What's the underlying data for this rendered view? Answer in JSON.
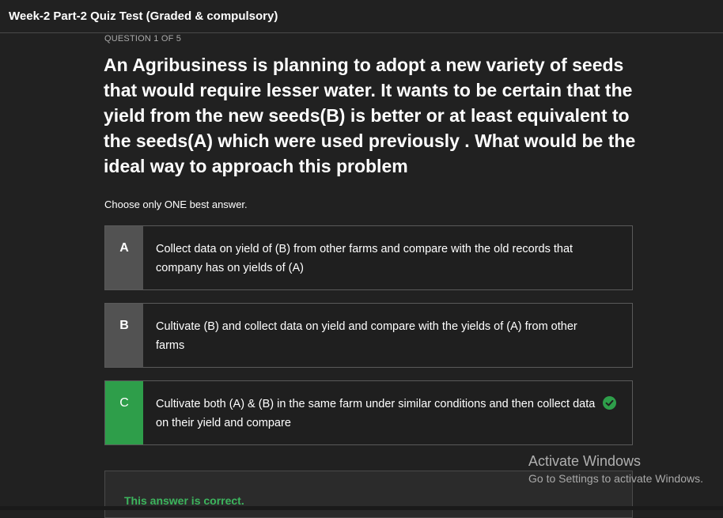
{
  "header": {
    "title": "Week-2 Part-2 Quiz Test (Graded & compulsory)"
  },
  "quiz": {
    "question_counter": "QUESTION 1 OF 5",
    "question_text": "An Agribusiness is planning to adopt a new variety of seeds that would require lesser water. It wants to be certain that the yield from the new seeds(B) is better or at least equivalent to the seeds(A) which were used previously . What would be the ideal way to approach this problem",
    "instruction": "Choose only ONE best answer.",
    "options": [
      {
        "letter": "A",
        "text": "Collect data on yield of (B) from other farms and compare with the old records that company has on yields of (A)"
      },
      {
        "letter": "B",
        "text": "Cultivate (B) and collect data on yield and compare with the yields of (A) from other farms"
      },
      {
        "letter": "C",
        "text": "Cultivate both (A) & (B) in the same farm under similar conditions and then collect data on their yield and compare",
        "selected_correct": true,
        "icon": "check-circle-icon"
      }
    ],
    "feedback": "This answer is correct."
  },
  "watermark": {
    "title": "Activate Windows",
    "subtitle": "Go to Settings to activate Windows."
  },
  "colors": {
    "background": "#212121",
    "letter_box": "#525252",
    "correct_green": "#2e9e4a",
    "feedback_text": "#3cb55d"
  }
}
